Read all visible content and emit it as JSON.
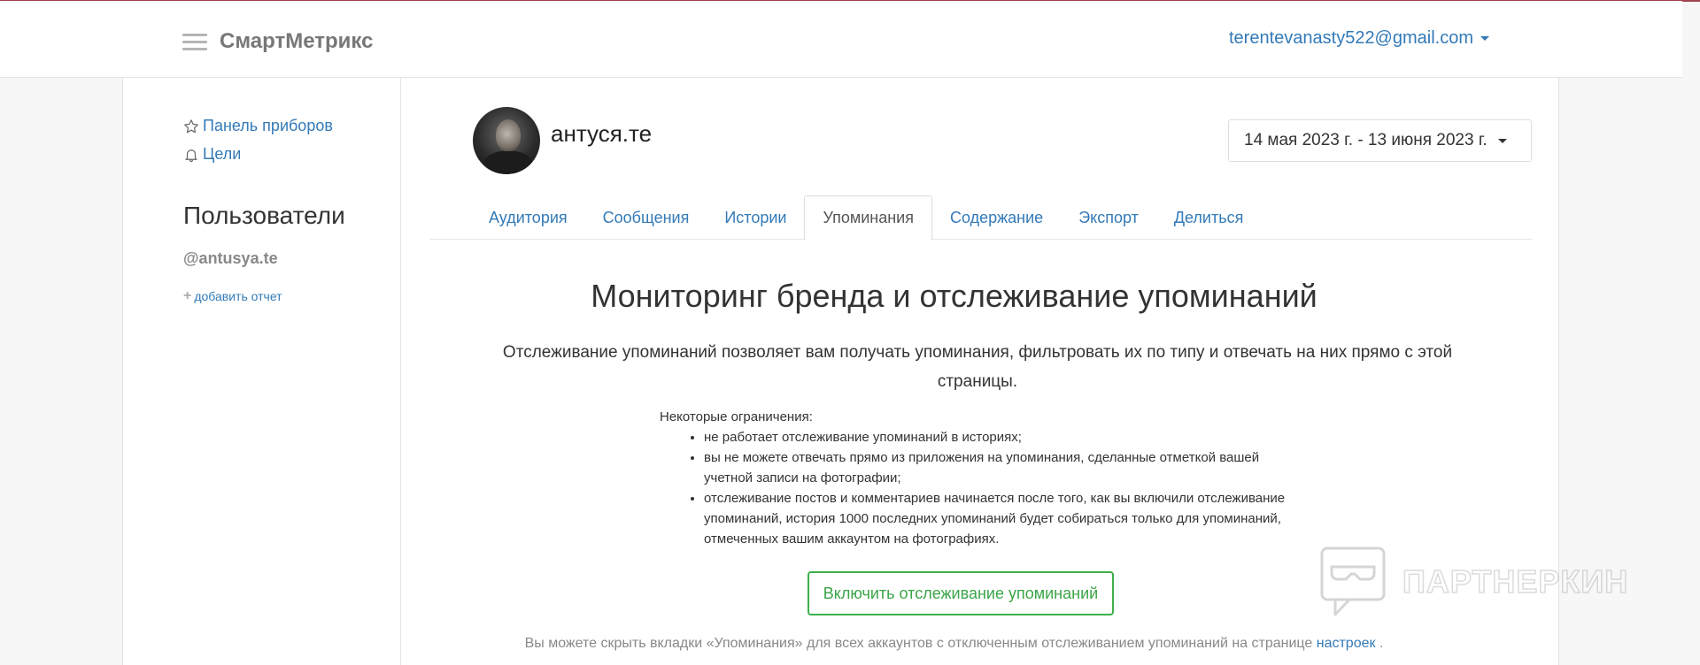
{
  "navbar": {
    "brand": "СмартМетрикс",
    "user_email": "terentevanasty522@gmail.com"
  },
  "sidebar": {
    "links": [
      {
        "label": "Панель приборов",
        "icon": "star-icon"
      },
      {
        "label": "Цели",
        "icon": "bell-icon"
      }
    ],
    "heading": "Пользователи",
    "account": "@antusya.te",
    "add_report": "добавить отчет"
  },
  "profile": {
    "name": "антуся.те",
    "date_range": "14 мая 2023 г. - 13 июня 2023 г."
  },
  "tabs": [
    {
      "label": "Аудитория",
      "active": false
    },
    {
      "label": "Сообщения",
      "active": false
    },
    {
      "label": "Истории",
      "active": false
    },
    {
      "label": "Упоминания",
      "active": true
    },
    {
      "label": "Содержание",
      "active": false
    },
    {
      "label": "Экспорт",
      "active": false
    },
    {
      "label": "Делиться",
      "active": false
    }
  ],
  "mentions": {
    "title": "Мониторинг бренда и отслеживание упоминаний",
    "description": "Отслеживание упоминаний позволяет вам получать упоминания, фильтровать их по типу и отвечать на них прямо с этой страницы.",
    "limits_heading": "Некоторые ограничения:",
    "limits": [
      "не работает отслеживание упоминаний в историях;",
      "вы не можете отвечать прямо из приложения на упоминания, сделанные отметкой вашей учетной записи на фотографии;",
      "отслеживание постов и комментариев начинается после того, как вы включили отслеживание упоминаний, история 1000 последних упоминаний будет собираться только для упоминаний, отмеченных вашим аккаунтом на фотографиях."
    ],
    "enable_button": "Включить отслеживание упоминаний",
    "footer_text": "Вы можете скрыть вкладки «Упоминания» для всех аккаунтов с отключенным отслеживанием упоминаний на странице",
    "footer_link": "настроек",
    "footer_end": "."
  },
  "watermark": {
    "text": "ПАРТНЕРКИН"
  },
  "colors": {
    "link": "#337ab7",
    "button_green": "#3db04a",
    "top_accent": "#a0434f"
  }
}
